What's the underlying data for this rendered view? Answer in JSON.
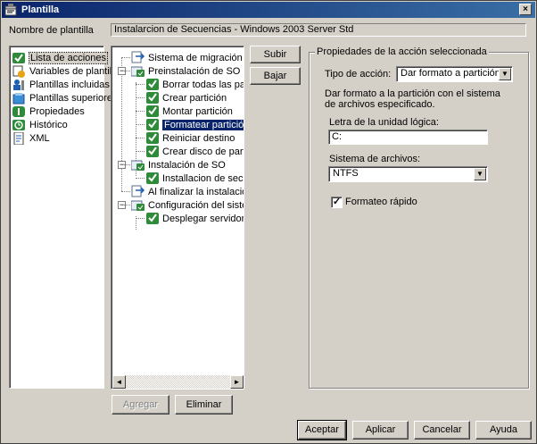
{
  "window": {
    "title": "Plantilla",
    "close_label": "×"
  },
  "template_name": {
    "label": "Nombre de plantilla",
    "value": "Instalarcion de Secuencias - Windows 2003 Server Std"
  },
  "nav": {
    "items": [
      {
        "label": "Lista de acciones",
        "icon": "action-list-icon",
        "selected": true
      },
      {
        "label": "Variables de plantilla",
        "icon": "variables-icon"
      },
      {
        "label": "Plantillas incluidas",
        "icon": "included-templates-icon"
      },
      {
        "label": "Plantillas superiores",
        "icon": "parent-templates-icon"
      },
      {
        "label": "Propiedades",
        "icon": "properties-icon"
      },
      {
        "label": "Histórico",
        "icon": "history-icon"
      },
      {
        "label": "XML",
        "icon": "xml-icon"
      }
    ]
  },
  "tree": {
    "nodes": [
      {
        "label": "Sistema de migración",
        "level": 0,
        "icon": "migration-icon"
      },
      {
        "label": "Preinstalación de SO",
        "level": 0,
        "expander": "−",
        "icon": "folder-task-icon"
      },
      {
        "label": "Borrar todas las particior",
        "level": 1,
        "icon": "task-icon"
      },
      {
        "label": "Crear partición",
        "level": 1,
        "icon": "task-icon"
      },
      {
        "label": "Montar partición",
        "level": 1,
        "icon": "task-icon"
      },
      {
        "label": "Formatear partición",
        "level": 1,
        "icon": "task-icon",
        "selected": true
      },
      {
        "label": "Reiniciar destino",
        "level": 1,
        "icon": "task-icon"
      },
      {
        "label": "Crear disco de partición",
        "level": 1,
        "icon": "task-icon"
      },
      {
        "label": "Instalación de SO",
        "level": 0,
        "expander": "−",
        "icon": "folder-task-icon"
      },
      {
        "label": "Installacion de secuenc",
        "level": 1,
        "icon": "task-icon"
      },
      {
        "label": "Al finalizar la instalación del S",
        "level": 0,
        "icon": "migration-icon"
      },
      {
        "label": "Configuración del sistema",
        "level": 0,
        "expander": "−",
        "icon": "folder-task-icon"
      },
      {
        "label": "Desplegar servidor de a",
        "level": 1,
        "icon": "task-icon"
      }
    ],
    "scroll_left": "◄",
    "scroll_right": "►"
  },
  "order_buttons": {
    "up": "Subir",
    "down": "Bajar"
  },
  "tree_buttons": {
    "add": "Agregar",
    "remove": "Eliminar"
  },
  "properties": {
    "title": "Propiedades de la acción seleccionada",
    "action_type_label": "Tipo de acción:",
    "action_type_value": "Dar formato a partición",
    "description": "Dar formato a la partición con el sistema de archivos especificado.",
    "drive_letter_label": "Letra de la unidad lógica:",
    "drive_letter_value": "C:",
    "filesystem_label": "Sistema de archivos:",
    "filesystem_value": "NTFS",
    "quick_format_label": "Formateo rápido",
    "quick_format_checked": true,
    "dropdown_arrow": "▼",
    "check_mark": "✓"
  },
  "footer": {
    "ok": "Aceptar",
    "apply": "Aplicar",
    "cancel": "Cancelar",
    "help": "Ayuda"
  }
}
